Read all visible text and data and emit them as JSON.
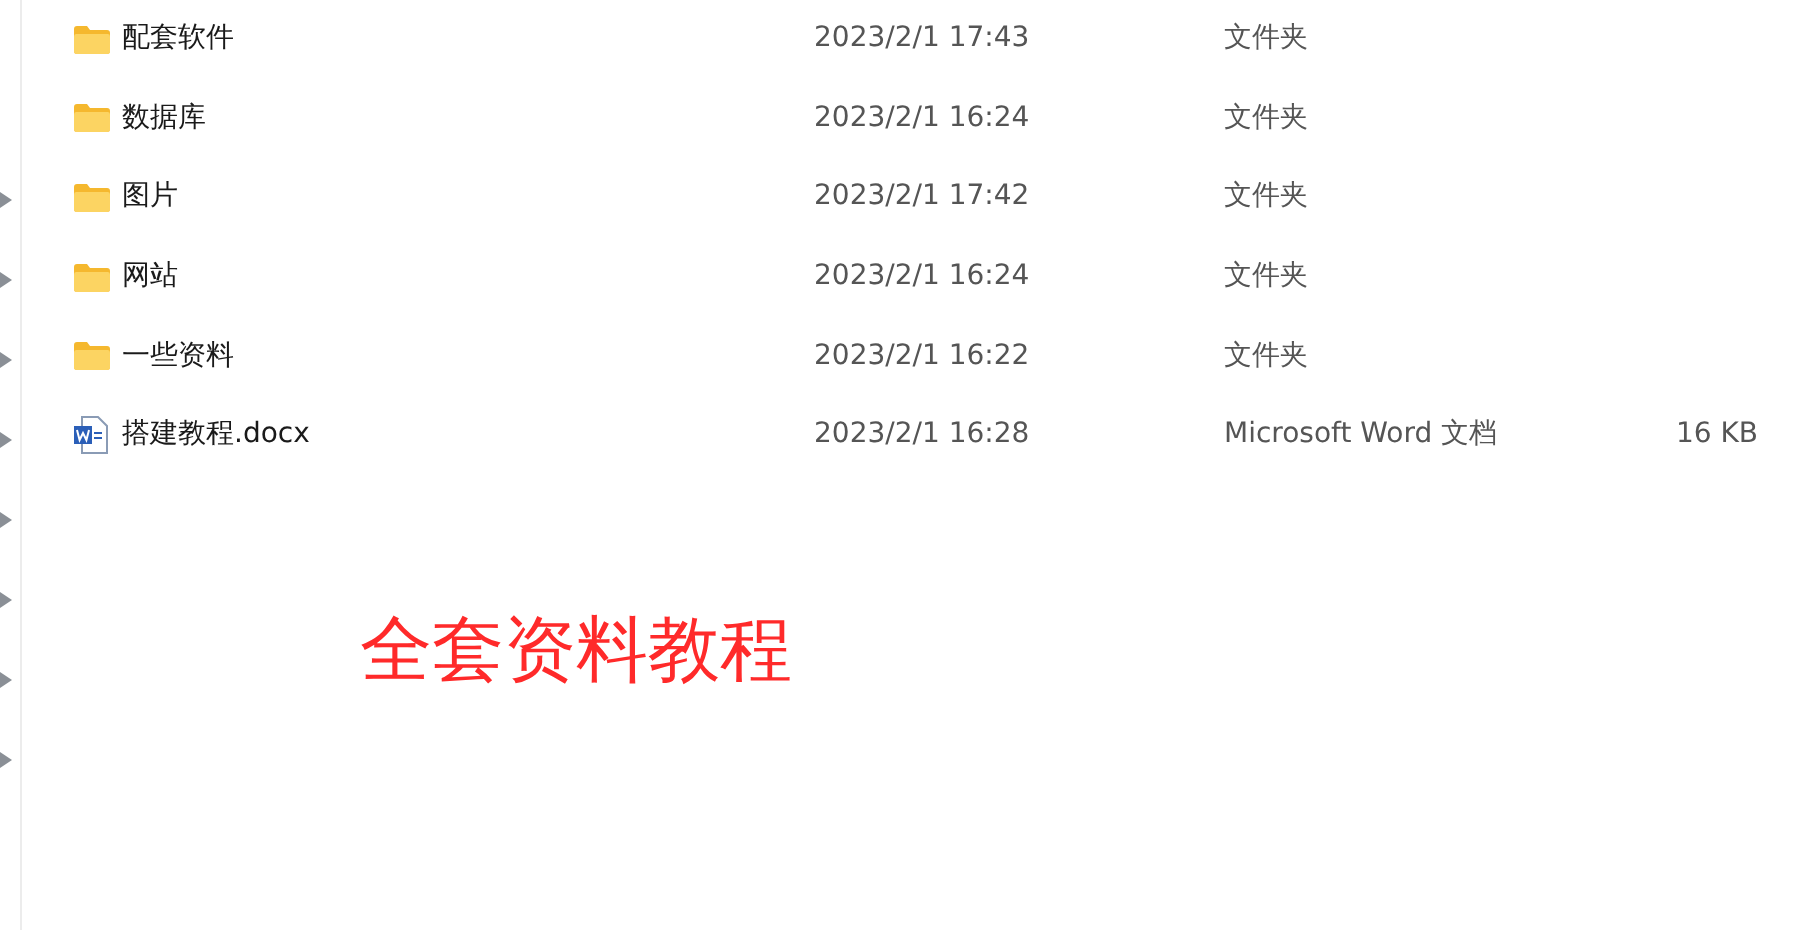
{
  "files": [
    {
      "kind": "folder",
      "name": "配套软件",
      "date": "2023/2/1 17:43",
      "type": "文件夹"
    },
    {
      "kind": "folder",
      "name": "数据库",
      "date": "2023/2/1 16:24",
      "type": "文件夹"
    },
    {
      "kind": "folder",
      "name": "图片",
      "date": "2023/2/1 17:42",
      "type": "文件夹"
    },
    {
      "kind": "folder",
      "name": "网站",
      "date": "2023/2/1 16:24",
      "type": "文件夹"
    },
    {
      "kind": "folder",
      "name": "一些资料",
      "date": "2023/2/1 16:22",
      "type": "文件夹"
    },
    {
      "kind": "document",
      "name": "搭建教程.docx",
      "date": "2023/2/1 16:28",
      "type": "Microsoft Word 文档",
      "size": "16 KB"
    }
  ],
  "annotation": "全套资料教程"
}
